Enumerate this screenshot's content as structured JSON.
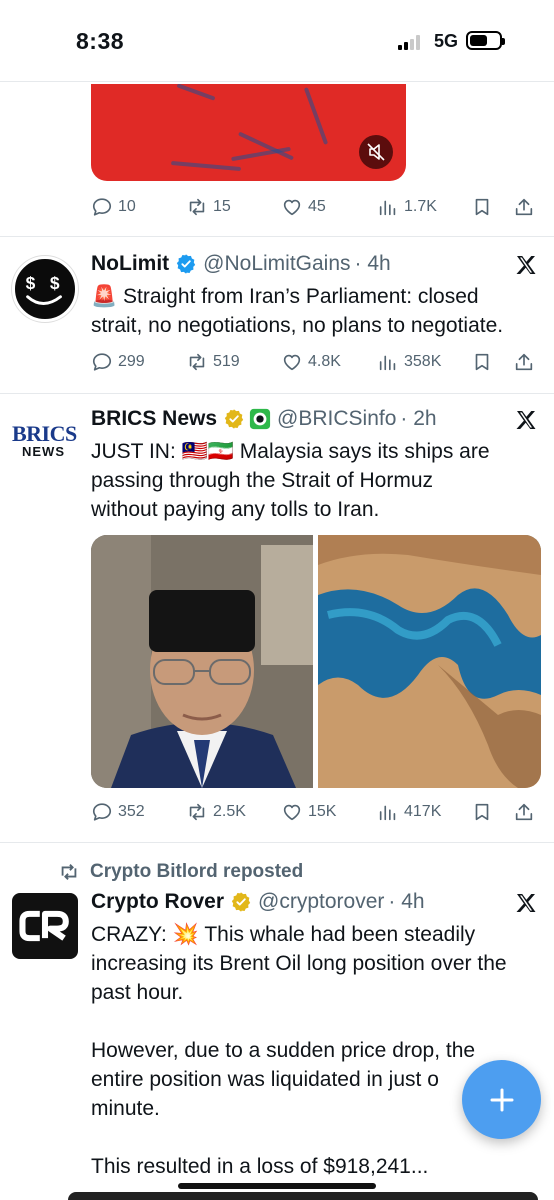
{
  "status_bar": {
    "time": "8:38",
    "network": "5G"
  },
  "previous_post": {
    "actions": {
      "replies": "10",
      "reposts": "15",
      "likes": "45",
      "views": "1.7K"
    }
  },
  "posts": [
    {
      "name": "NoLimit",
      "handle": "@NoLimitGains",
      "time": "· 4h",
      "emoji": "🚨",
      "text_lines": [
        "Straight from Iran’s Parliament: closed",
        "strait, no negotiations, no plans to negotiate."
      ],
      "actions": {
        "replies": "299",
        "reposts": "519",
        "likes": "4.8K",
        "views": "358K"
      }
    },
    {
      "name": "BRICS News",
      "handle": "@BRICSinfo",
      "time": "· 2h",
      "avatar_text": [
        "BRICS",
        "NEWS"
      ],
      "flags": "🇲🇾🇮🇷",
      "text_lines": [
        "JUST IN:",
        "Malaysia says its ships are",
        "passing through the Strait of Hormuz",
        "without paying any tolls to Iran."
      ],
      "actions": {
        "replies": "352",
        "reposts": "2.5K",
        "likes": "15K",
        "views": "417K"
      }
    },
    {
      "repost_label": "Crypto Bitlord reposted",
      "name": "Crypto Rover",
      "handle": "@cryptorover",
      "time": "· 4h",
      "emoji": "💥",
      "text_lines": [
        "CRAZY:",
        "This whale had been steadily",
        "increasing its Brent Oil long position over the",
        "past hour.",
        "However, due to a sudden price drop, the",
        "entire position was liquidated in just o",
        "minute.",
        "This resulted in a loss of $918,241..."
      ]
    }
  ],
  "icons": [
    "reply-icon",
    "repost-icon",
    "like-icon",
    "views-icon",
    "bookmark-icon",
    "share-icon",
    "verified-icon",
    "x-logo-icon",
    "compose-icon"
  ],
  "colors": {
    "accent": "#4d9ef0",
    "verified_blue": "#1d9bf0",
    "verified_gold": "#e2b719",
    "muted": "#536471"
  }
}
